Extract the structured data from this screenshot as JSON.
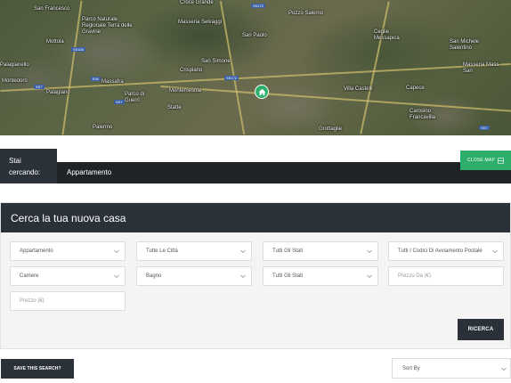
{
  "map": {
    "towns": [
      "San Francesco",
      "Parco Naturale Regionale Terra delle Gravine",
      "Croce Grande",
      "Pozzo Salerno",
      "Masseria Selvaggi",
      "San Paolo",
      "Mottola",
      "Palagianello",
      "Montedoro",
      "Palagiano",
      "Massafra",
      "San Simone",
      "Crispiano",
      "Parco di Guerri",
      "Montemesola",
      "Villa Castelli",
      "Ceglie Messapica",
      "San Michele Salentino",
      "Masseria Mass-Sari",
      "Capece",
      "Statte",
      "Palermo",
      "Grottaglie",
      "Carosino Francavilla"
    ],
    "shields": [
      "SS172",
      "SS100",
      "SS7",
      "SS172",
      "E90",
      "SS7",
      "SS7"
    ]
  },
  "search_summary": {
    "label_line1": "Stai",
    "label_line2": "cercando:",
    "value": "Appartamento",
    "close_map_label": "CLOSE MAP"
  },
  "panel": {
    "title": "Cerca la tua nuova casa",
    "fields": {
      "type": "Appartamento",
      "city": "Tutte Le Città",
      "status1": "Tutti Gli Stati",
      "postal": "Tutti I Codici Di Avviamento Postale",
      "rooms": "Camere",
      "bath": "Bagno",
      "status2": "Tutti Gli Stati",
      "price_from_placeholder": "Prezzo Da (€)",
      "price_to_placeholder": "Prezzo (€)"
    },
    "search_button": "RICERCA"
  },
  "footer": {
    "save_search": "SAVE THIS SEARCH?",
    "sort_by": "Sort By"
  },
  "colors": {
    "accent": "#2eae6b",
    "dark": "#2a3138"
  }
}
